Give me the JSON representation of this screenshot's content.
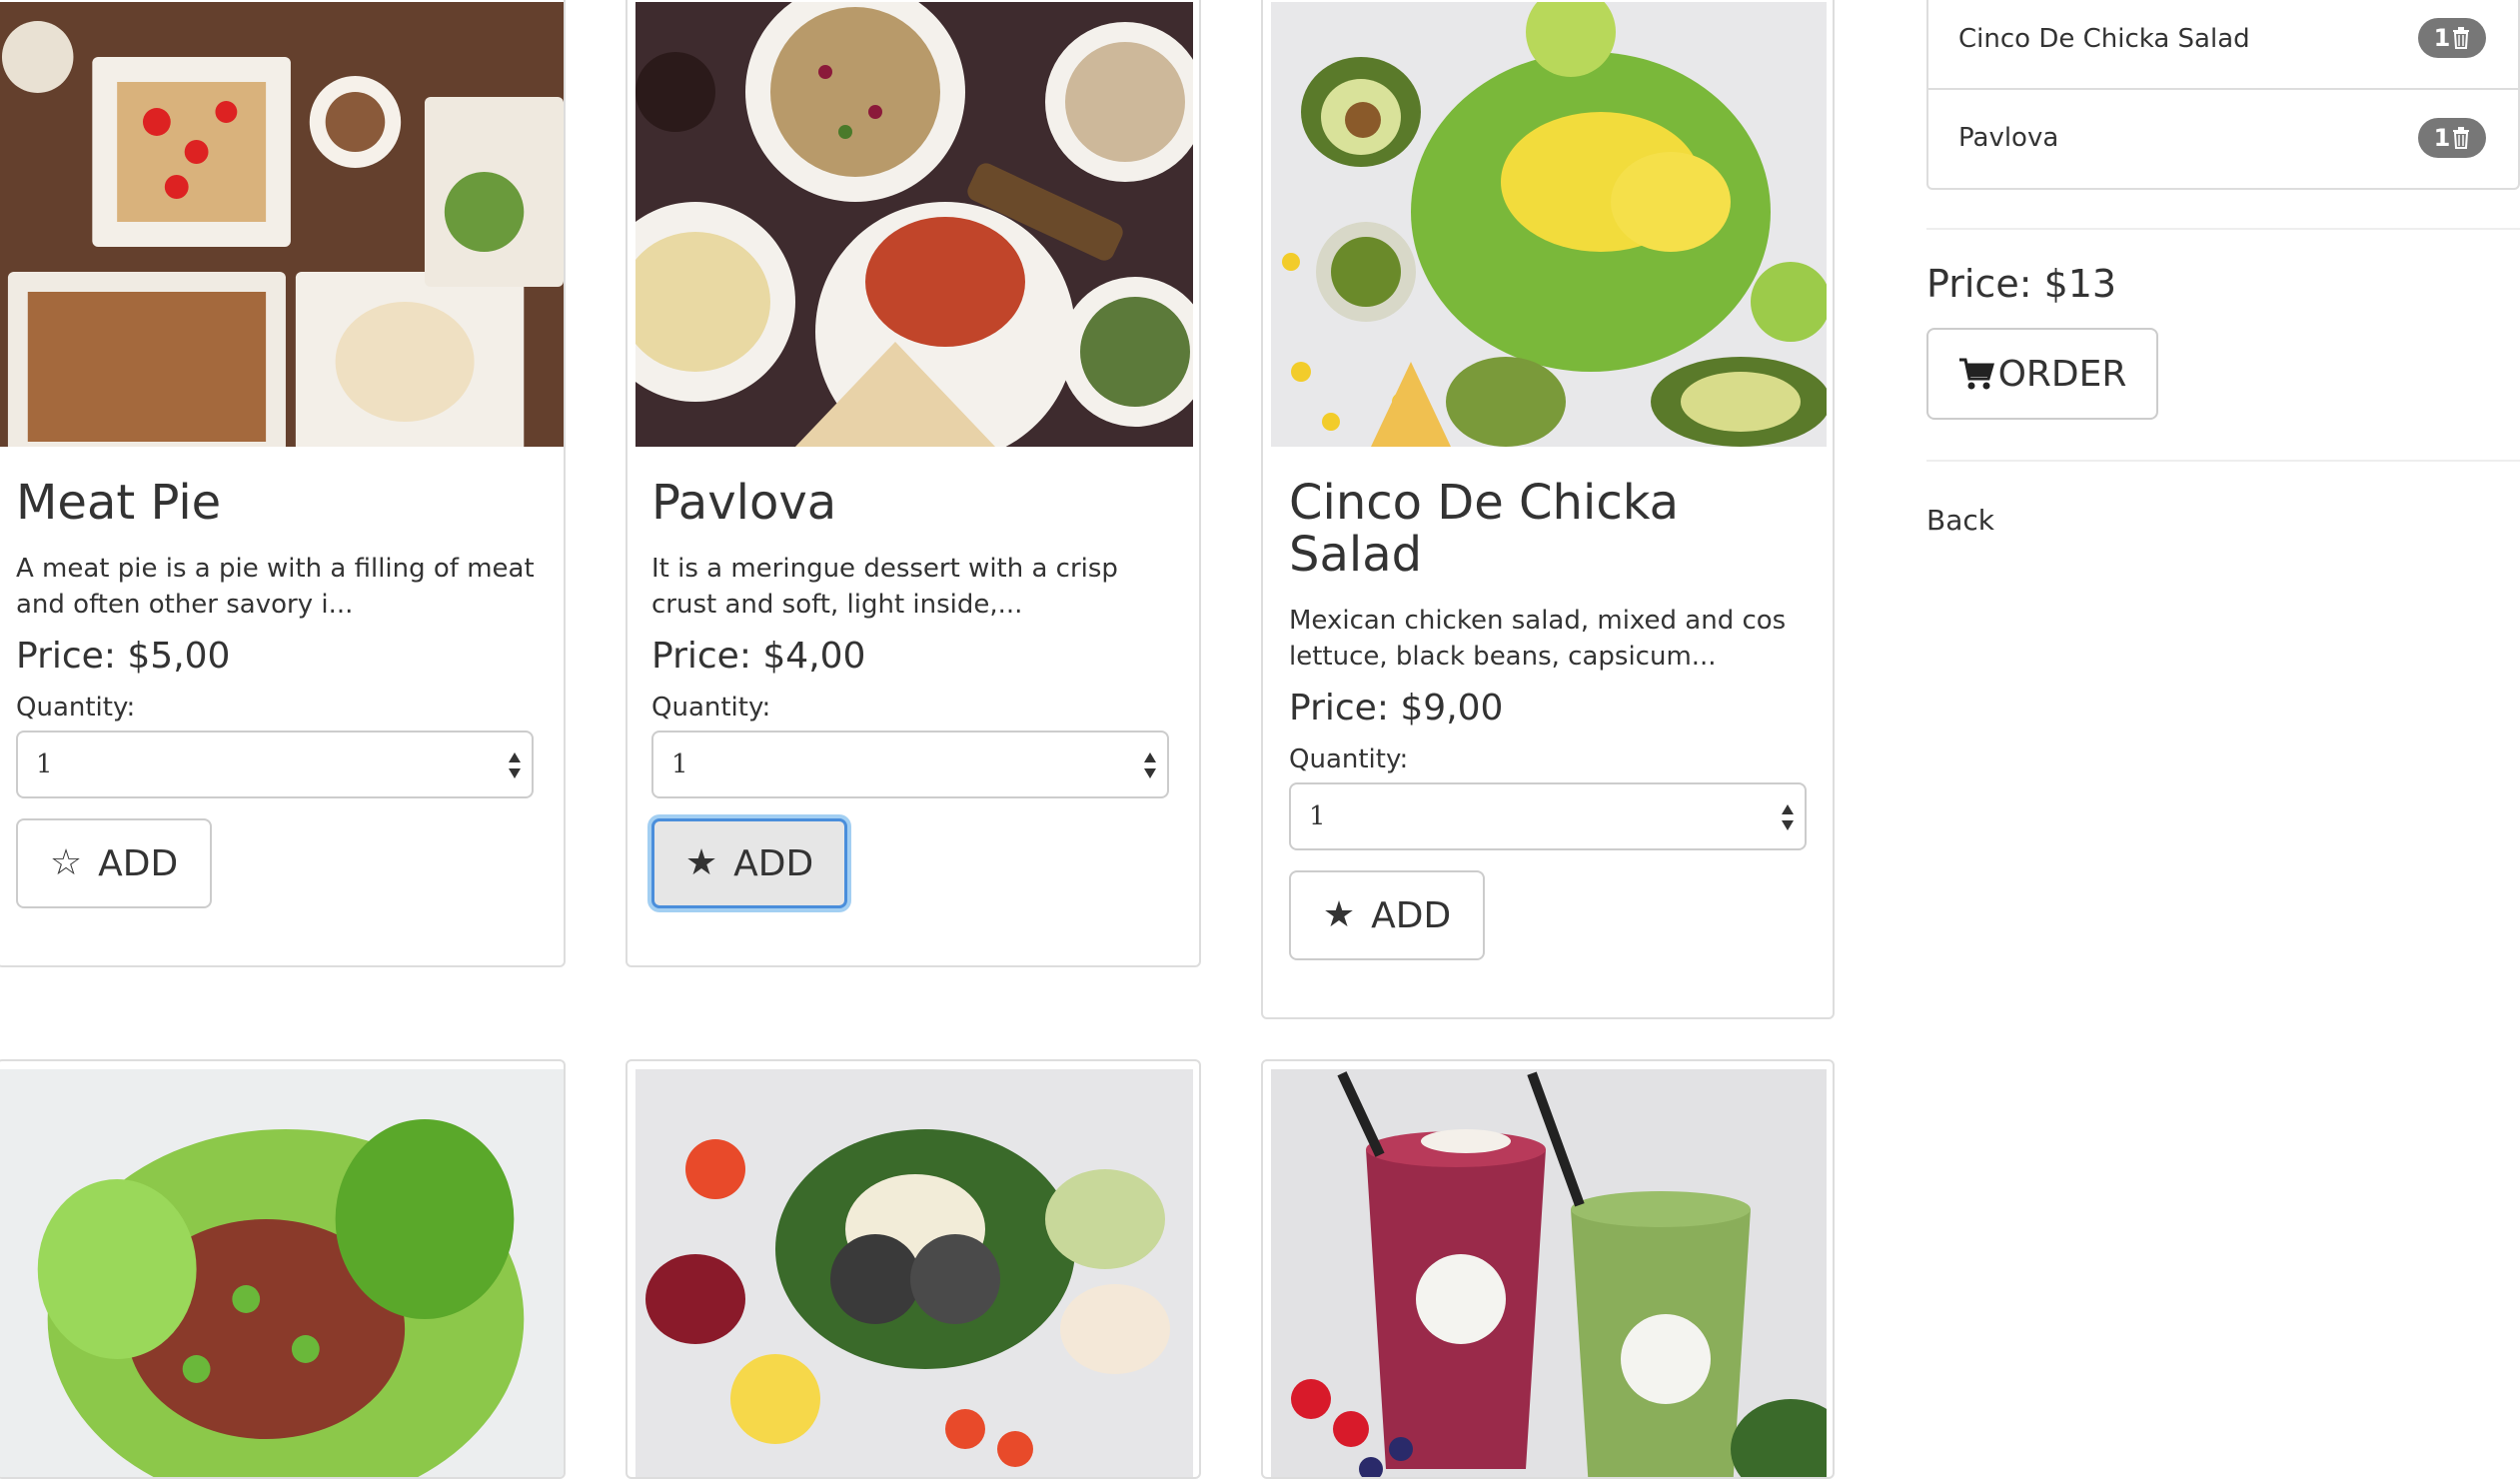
{
  "products": [
    {
      "name": "Meat Pie",
      "description": "A meat pie is a pie with a filling of meat and often other savory i...",
      "price": "Price: $5,00",
      "quantity_label": "Quantity:",
      "quantity": "1",
      "add_label": "ADD",
      "star": "☆"
    },
    {
      "name": "Pavlova",
      "description": "It is a meringue dessert with a crisp crust and soft, light inside,...",
      "price": "Price: $4,00",
      "quantity_label": "Quantity:",
      "quantity": "1",
      "add_label": "ADD",
      "star": "★"
    },
    {
      "name": "Cinco De Chicka Salad",
      "description": "Mexican chicken salad, mixed and cos lettuce, black beans, capsicum...",
      "price": "Price: $9,00",
      "quantity_label": "Quantity:",
      "quantity": "1",
      "add_label": "ADD",
      "star": "★"
    }
  ],
  "cart": {
    "items": [
      {
        "name": "Cinco De Chicka Salad",
        "count": "1"
      },
      {
        "name": "Pavlova",
        "count": "1"
      }
    ],
    "price": "Price: $13",
    "order_label": "ORDER",
    "back_label": "Back"
  },
  "colors": {
    "border": "#dddddd",
    "badge": "#777777",
    "focus": "#4a8edb"
  }
}
